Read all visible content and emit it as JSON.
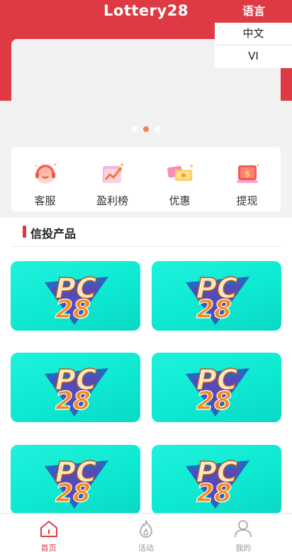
{
  "header": {
    "title": "Lottery28",
    "language_label": "语言"
  },
  "language_menu": {
    "options": [
      "中文",
      "VI"
    ]
  },
  "banner": {
    "dots": 3,
    "active_dot": 1
  },
  "quick_menu": {
    "items": [
      {
        "label": "客服",
        "icon": "customer-service-icon"
      },
      {
        "label": "盈利榜",
        "icon": "profit-chart-icon"
      },
      {
        "label": "优惠",
        "icon": "coupon-icon"
      },
      {
        "label": "提现",
        "icon": "withdraw-icon"
      }
    ]
  },
  "products": {
    "section_title": "信投产品",
    "cards": [
      {
        "logo_top": "PC",
        "logo_bottom": "28"
      },
      {
        "logo_top": "PC",
        "logo_bottom": "28"
      },
      {
        "logo_top": "PC",
        "logo_bottom": "28"
      },
      {
        "logo_top": "PC",
        "logo_bottom": "28"
      },
      {
        "logo_top": "PC",
        "logo_bottom": "28"
      },
      {
        "logo_top": "PC",
        "logo_bottom": "28"
      }
    ]
  },
  "tabbar": {
    "items": [
      {
        "label": "首页",
        "icon": "home-icon",
        "active": true
      },
      {
        "label": "活动",
        "icon": "flame-icon",
        "active": false
      },
      {
        "label": "我的",
        "icon": "user-icon",
        "active": false
      }
    ]
  },
  "colors": {
    "brand": "#dd3a43",
    "active_dot": "#f0834a",
    "card_bg": "#0ee9d1"
  }
}
